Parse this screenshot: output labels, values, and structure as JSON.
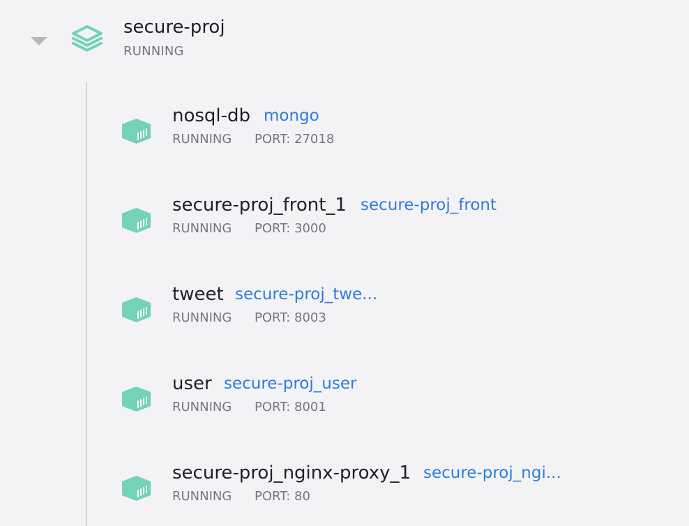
{
  "app": {
    "name": "secure-proj",
    "status": "RUNNING",
    "icon": "stack-icon"
  },
  "colors": {
    "background": "#f3f3f6",
    "icon_teal": "#73d2b8",
    "link_blue": "#2f7bd8",
    "muted_text": "#76767d",
    "tree_line": "#d0d0d3"
  },
  "containers": [
    {
      "name": "nosql-db",
      "image": "mongo",
      "status": "RUNNING",
      "port": "PORT: 27018",
      "icon": "container-icon"
    },
    {
      "name": "secure-proj_front_1",
      "image": "secure-proj_front",
      "status": "RUNNING",
      "port": "PORT: 3000",
      "icon": "container-icon"
    },
    {
      "name": "tweet",
      "image": "secure-proj_twe...",
      "status": "RUNNING",
      "port": "PORT: 8003",
      "icon": "container-icon"
    },
    {
      "name": "user",
      "image": "secure-proj_user",
      "status": "RUNNING",
      "port": "PORT: 8001",
      "icon": "container-icon"
    },
    {
      "name": "secure-proj_nginx-proxy_1",
      "image": "secure-proj_ngi...",
      "status": "RUNNING",
      "port": "PORT: 80",
      "icon": "container-icon"
    }
  ]
}
